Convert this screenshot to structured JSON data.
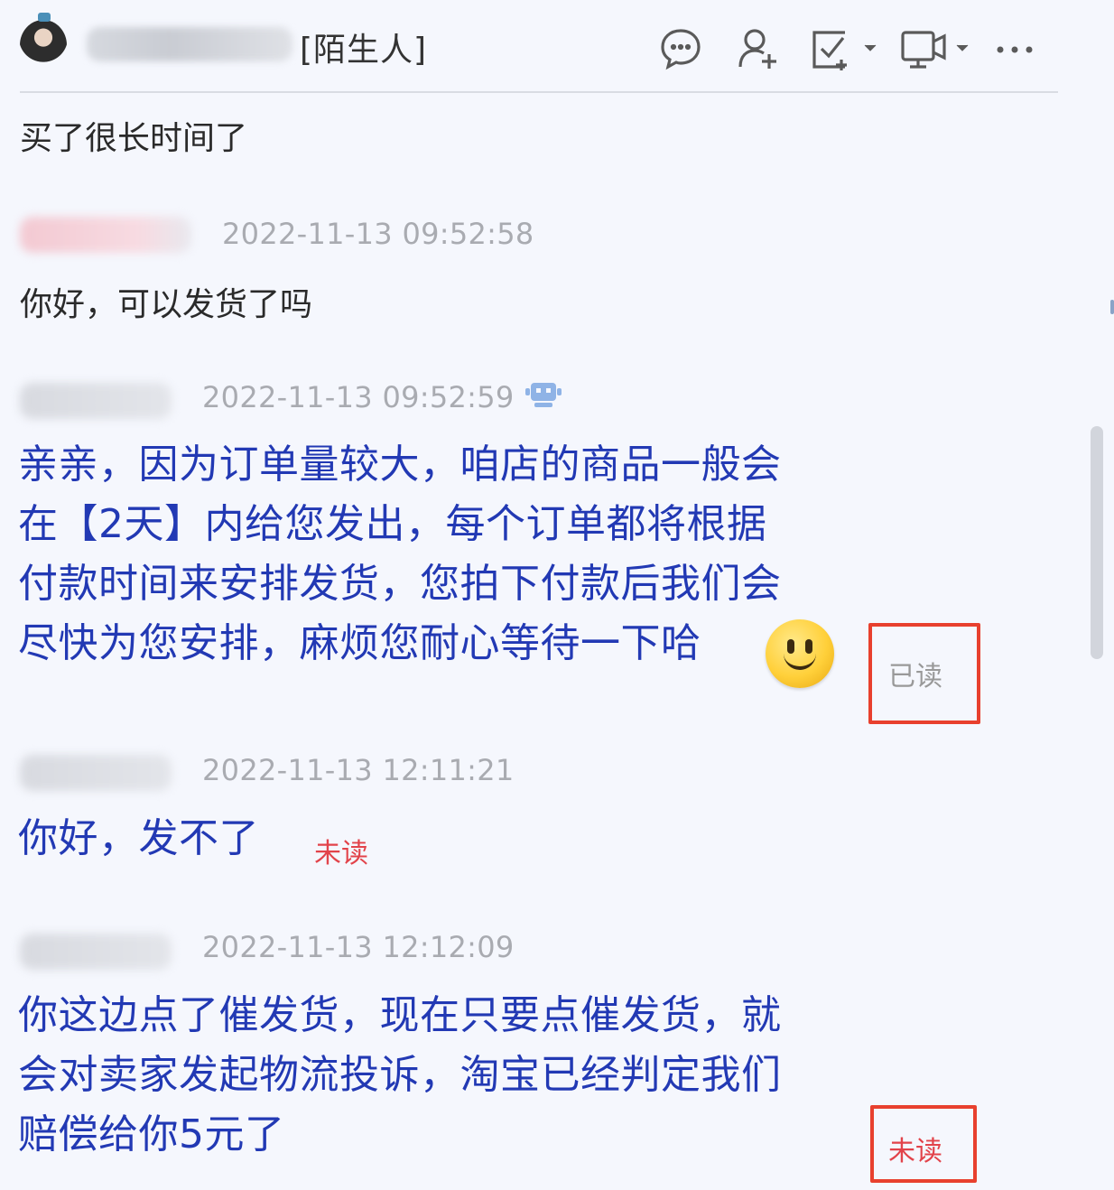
{
  "header": {
    "stranger_tag": "[陌生人]",
    "icons": [
      "chat-bubble-icon",
      "add-contact-icon",
      "task-icon",
      "video-icon",
      "more-icon"
    ]
  },
  "messages": [
    {
      "text": "买了很长时间了"
    },
    {
      "timestamp": "2022-11-13 09:52:58",
      "text": "你好，可以发货了吗"
    },
    {
      "timestamp": "2022-11-13 09:52:59",
      "lines": [
        "亲亲，因为订单量较大，咱店的商品一般会",
        "在【2天】内给您发出，每个订单都将根据",
        "付款时间来安排发货，您拍下付款后我们会",
        "尽快为您安排，麻烦您耐心等待一下哈"
      ],
      "status": "已读"
    },
    {
      "timestamp": "2022-11-13 12:11:21",
      "text": "你好，发不了",
      "status": "未读"
    },
    {
      "timestamp": "2022-11-13 12:12:09",
      "lines": [
        "你这边点了催发货，现在只要点催发货，就",
        "会对卖家发起物流投诉，淘宝已经判定我们",
        "赔偿给你5元了"
      ],
      "status": "未读"
    }
  ],
  "colors": {
    "background": "#f5f7fd",
    "merchant_text": "#2239b4",
    "timestamp": "#a9abb1",
    "unread": "#e2434a",
    "highlight_box": "#e8402e"
  }
}
